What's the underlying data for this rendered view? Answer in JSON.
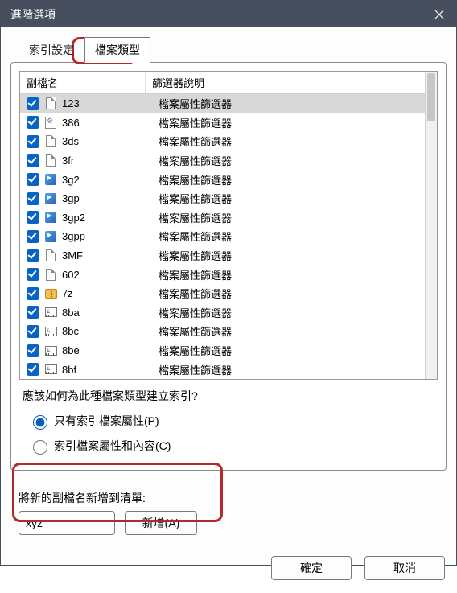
{
  "dialog": {
    "title": "進階選項"
  },
  "tabs": {
    "index_settings": "索引設定",
    "file_types": "檔案類型"
  },
  "list": {
    "headers": {
      "ext": "副檔名",
      "desc": "篩選器說明"
    },
    "rows": [
      {
        "ext": "123",
        "desc": "檔案屬性篩選器",
        "icon": "blank",
        "selected": true
      },
      {
        "ext": "386",
        "desc": "檔案屬性篩選器",
        "icon": "gear"
      },
      {
        "ext": "3ds",
        "desc": "檔案屬性篩選器",
        "icon": "blank"
      },
      {
        "ext": "3fr",
        "desc": "檔案屬性篩選器",
        "icon": "blank"
      },
      {
        "ext": "3g2",
        "desc": "檔案屬性篩選器",
        "icon": "wmp"
      },
      {
        "ext": "3gp",
        "desc": "檔案屬性篩選器",
        "icon": "wmp"
      },
      {
        "ext": "3gp2",
        "desc": "檔案屬性篩選器",
        "icon": "wmp"
      },
      {
        "ext": "3gpp",
        "desc": "檔案屬性篩選器",
        "icon": "wmp"
      },
      {
        "ext": "3MF",
        "desc": "檔案屬性篩選器",
        "icon": "blank"
      },
      {
        "ext": "602",
        "desc": "檔案屬性篩選器",
        "icon": "blank"
      },
      {
        "ext": "7z",
        "desc": "檔案屬性篩選器",
        "icon": "zip"
      },
      {
        "ext": "8ba",
        "desc": "檔案屬性篩選器",
        "icon": "vid"
      },
      {
        "ext": "8bc",
        "desc": "檔案屬性篩選器",
        "icon": "vid"
      },
      {
        "ext": "8be",
        "desc": "檔案屬性篩選器",
        "icon": "vid"
      },
      {
        "ext": "8bf",
        "desc": "檔案屬性篩選器",
        "icon": "vid"
      }
    ]
  },
  "index_opts": {
    "question": "應該如何為此種檔案類型建立索引?",
    "props_only": "只有索引檔案屬性(P)",
    "props_content": "索引檔案屬性和內容(C)"
  },
  "add": {
    "label": "將新的副檔名新增到清單:",
    "value": "xyz",
    "button": "新增(A)"
  },
  "footer": {
    "ok": "確定",
    "cancel": "取消"
  }
}
